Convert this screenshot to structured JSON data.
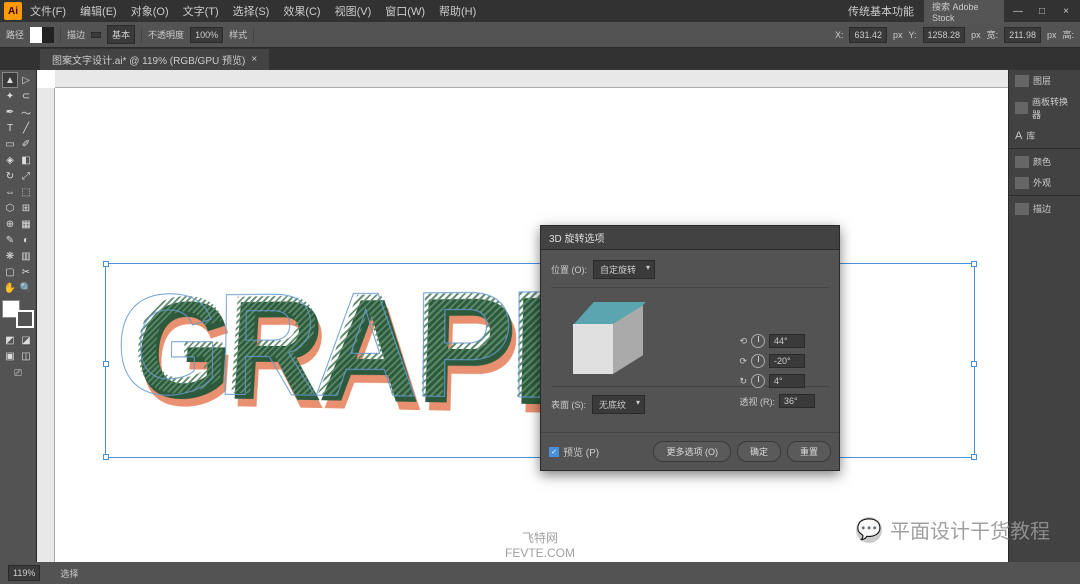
{
  "app": {
    "logo": "Ai",
    "workspace": "传统基本功能",
    "search_placeholder": "搜索 Adobe Stock"
  },
  "menu": {
    "file": "文件(F)",
    "edit": "编辑(E)",
    "object": "对象(O)",
    "type": "文字(T)",
    "select": "选择(S)",
    "effect": "效果(C)",
    "view": "视图(V)",
    "window": "窗口(W)",
    "help": "帮助(H)"
  },
  "options": {
    "path_label": "路径",
    "stroke_label": "描边",
    "stroke_val": "",
    "uniform": "基本",
    "opacity_label": "不透明度",
    "opacity_val": "100%",
    "style_label": "样式",
    "x_label": "X:",
    "x_val": "631.42",
    "y_label": "Y:",
    "y_val": "1258.28",
    "w_label": "宽:",
    "w_val": "211.98",
    "h_label": "高:",
    "suffix": "px"
  },
  "doc": {
    "tab": "图案文字设计.ai* @ 119% (RGB/GPU 预览)",
    "close": "×"
  },
  "artwork": {
    "text": "GRAPHIC"
  },
  "dialog": {
    "title": "3D 旋转选项",
    "position_label": "位置 (O):",
    "position_val": "自定旋转",
    "axis_x": "44°",
    "axis_y": "-20°",
    "axis_z": "4°",
    "perspective_label": "透视 (R):",
    "perspective_val": "36°",
    "surface_label": "表面 (S):",
    "surface_val": "无底纹",
    "preview_cb": "预览 (P)",
    "btn_more": "更多选项 (O)",
    "btn_ok": "确定",
    "btn_reset": "重置"
  },
  "panels": {
    "layers": "图层",
    "artboards": "画板转换器",
    "lib": "库",
    "color": "颜色",
    "swatch": "外观",
    "brush": "描边"
  },
  "status": {
    "zoom": "119%",
    "sel": "选择"
  },
  "watermark": {
    "center1": "飞特网",
    "center2": "FEVTE.COM",
    "right": "平面设计干货教程"
  }
}
